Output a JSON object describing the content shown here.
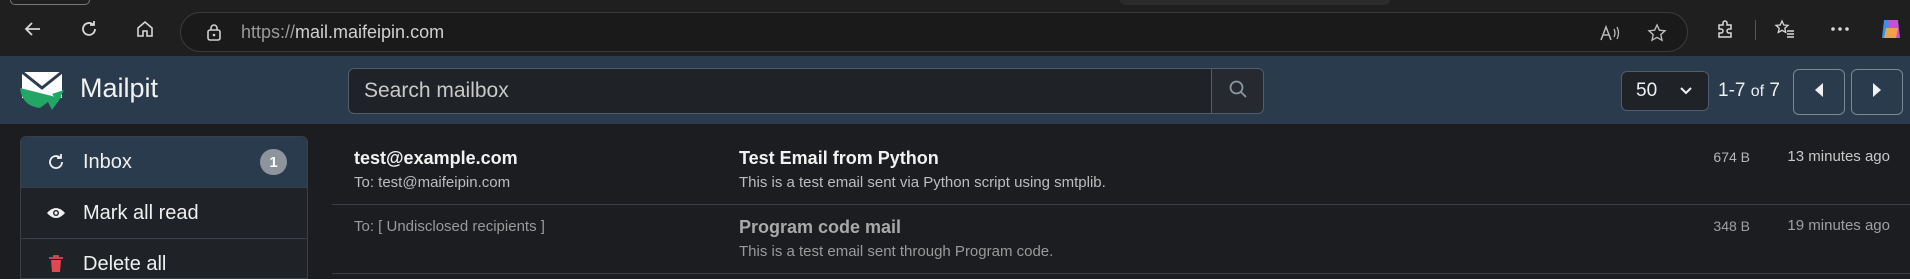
{
  "browser": {
    "url_protocol": "https://",
    "url_host": "mail.maifeipin.com",
    "icons": [
      "back-icon",
      "refresh-icon",
      "home-icon",
      "lock-icon",
      "read-aloud-icon",
      "favorite-icon",
      "extensions-icon",
      "favorites-bar-icon",
      "more-icon",
      "copilot-icon"
    ]
  },
  "app": {
    "brand": "Mailpit",
    "search_placeholder": "Search mailbox",
    "per_page": "50",
    "range_start": "1-7",
    "range_of": "of",
    "range_total": "7"
  },
  "sidebar": {
    "items": [
      {
        "label": "Inbox",
        "icon": "refresh-icon",
        "badge": "1"
      },
      {
        "label": "Mark all read",
        "icon": "eye-icon"
      },
      {
        "label": "Delete all",
        "icon": "trash-icon"
      }
    ]
  },
  "messages": [
    {
      "from": "test@example.com",
      "to": "To: test@maifeipin.com",
      "subject": "Test Email from Python",
      "snippet": "This is a test email sent via Python script using smtplib.",
      "size": "674 B",
      "age": "13 minutes ago",
      "read": false
    },
    {
      "from": "",
      "to": "To: [ Undisclosed recipients ]",
      "subject": "Program code mail",
      "snippet": "This is a test email sent through Program code.",
      "size": "348 B",
      "age": "19 minutes ago",
      "read": true
    }
  ],
  "colors": {
    "header_bg": "#2a3b4e",
    "page_bg": "#1b1d21",
    "delete_red": "#e0484f",
    "logo_green": "#22a565"
  }
}
